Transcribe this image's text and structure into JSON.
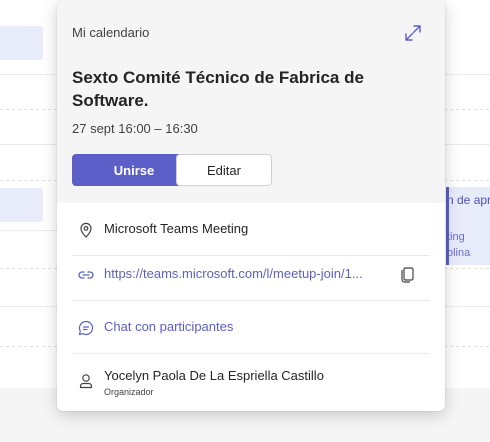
{
  "background": {
    "right_event_line1": "n de apre",
    "right_event_line2": "ting",
    "right_event_line3": "olina"
  },
  "popup": {
    "calendar_label": "Mi calendario",
    "title": "Sexto Comité Técnico de Fabrica de Software.",
    "time": "27 sept 16:00 – 16:30",
    "join_label": "Unirse",
    "edit_label": "Editar",
    "location": "Microsoft Teams Meeting",
    "meeting_link": "https://teams.microsoft.com/l/meetup-join/1...",
    "chat_label": "Chat con participantes",
    "organizer_name": "Yocelyn Paola De La Espriella Castillo",
    "organizer_role": "Organizador",
    "icons": [
      "expand-icon",
      "location-icon",
      "link-icon",
      "copy-icon",
      "chat-icon",
      "person-icon"
    ]
  },
  "colors": {
    "accent": "#5b5fc7",
    "event_background": "#e8ebfa",
    "header_background": "#f5f5f5"
  }
}
